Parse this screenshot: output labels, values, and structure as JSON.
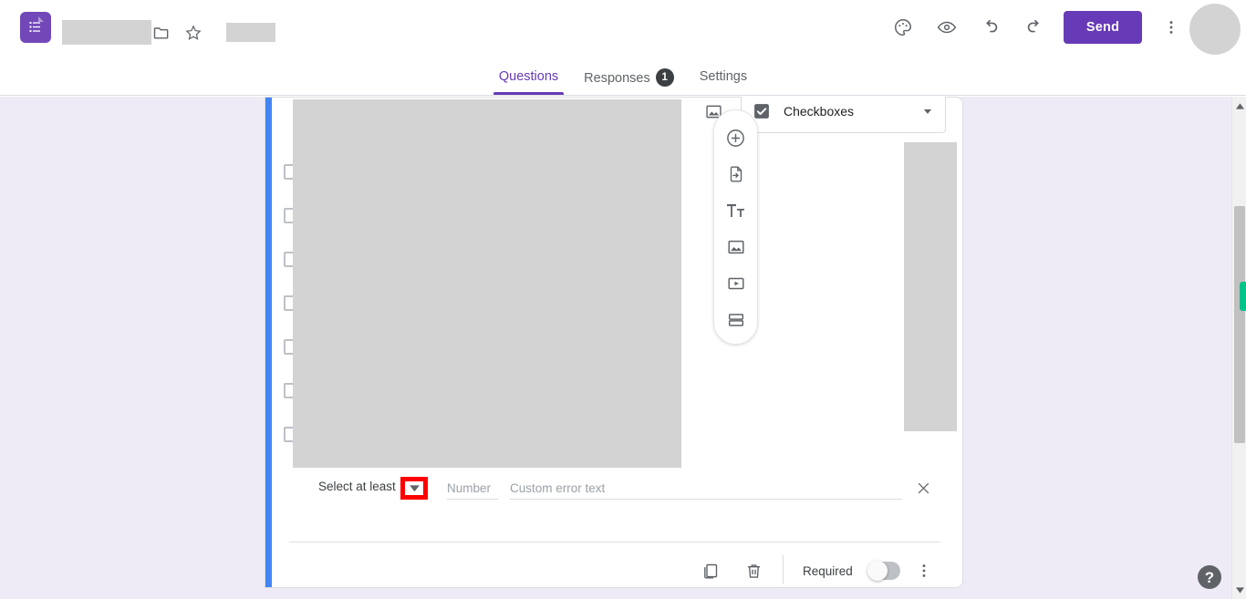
{
  "app": {
    "name": "Google Forms",
    "logo_icon": "forms-logo-icon",
    "accent_color": "#673AB7",
    "card_accent_color": "#4285F4",
    "highlight_color": "#FF0000"
  },
  "header": {
    "title_placeholder": "",
    "folder_icon": "folder-icon",
    "star_icon": "star-icon",
    "status_text": "",
    "theme_icon": "palette-icon",
    "preview_icon": "eye-icon",
    "undo_icon": "undo-icon",
    "redo_icon": "redo-icon",
    "send_label": "Send",
    "more_icon": "more-vert-icon",
    "avatar_icon": "avatar"
  },
  "tabs": [
    {
      "label": "Questions",
      "active": true,
      "badge": ""
    },
    {
      "label": "Responses",
      "active": false,
      "badge": "1"
    },
    {
      "label": "Settings",
      "active": false,
      "badge": ""
    }
  ],
  "question_card": {
    "title_text": "",
    "image_button_icon": "image-icon",
    "type_select": {
      "icon": "checkbox-checked-icon",
      "label": "Checkboxes",
      "chevron_icon": "chevron-down-icon"
    },
    "options_count": 7,
    "option_checkbox_icon": "checkbox-empty-icon",
    "validation": {
      "label": "Select at least",
      "dropdown_icon": "dropdown-triangle-icon",
      "dropdown_highlighted": true,
      "number_placeholder": "Number",
      "number_value": "",
      "error_placeholder": "Custom error text",
      "error_value": "",
      "close_icon": "close-icon"
    },
    "footer": {
      "duplicate_icon": "duplicate-icon",
      "delete_icon": "trash-icon",
      "required_label": "Required",
      "required_on": false,
      "more_icon": "more-vert-icon"
    }
  },
  "side_toolbar": [
    {
      "icon": "add-question-icon"
    },
    {
      "icon": "import-questions-icon"
    },
    {
      "icon": "add-title-icon"
    },
    {
      "icon": "add-image-icon"
    },
    {
      "icon": "add-video-icon"
    },
    {
      "icon": "add-section-icon"
    }
  ],
  "scrollbar": {
    "up_icon": "scroll-up-arrow-icon",
    "down_icon": "scroll-down-arrow-icon",
    "marker_color": "#00C389"
  },
  "help": {
    "label": "?"
  }
}
